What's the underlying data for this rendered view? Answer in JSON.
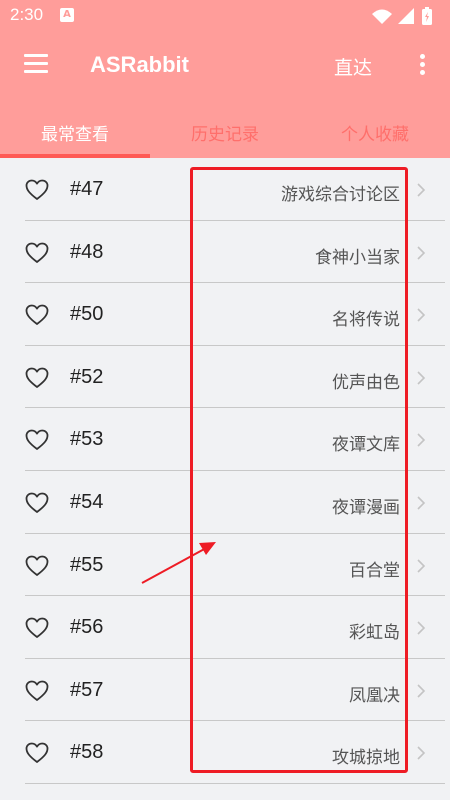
{
  "status_bar": {
    "time": "2:30",
    "notification_icon": "A"
  },
  "app_bar": {
    "title": "ASRabbit",
    "direct_label": "直达"
  },
  "tabs": [
    {
      "label": "最常查看",
      "active": true
    },
    {
      "label": "历史记录",
      "active": false
    },
    {
      "label": "个人收藏",
      "active": false
    }
  ],
  "items": [
    {
      "number": "#47",
      "name": "游戏综合讨论区"
    },
    {
      "number": "#48",
      "name": "食神小当家"
    },
    {
      "number": "#50",
      "name": "名将传说"
    },
    {
      "number": "#52",
      "name": "优声由色"
    },
    {
      "number": "#53",
      "name": "夜谭文库"
    },
    {
      "number": "#54",
      "name": "夜谭漫画"
    },
    {
      "number": "#55",
      "name": "百合堂"
    },
    {
      "number": "#56",
      "name": "彩虹岛"
    },
    {
      "number": "#57",
      "name": "凤凰决"
    },
    {
      "number": "#58",
      "name": "攻城掠地"
    }
  ],
  "colors": {
    "primary": "#ff9d9a",
    "tab_indicator": "#ff5a55",
    "tab_inactive": "#ff6f6b",
    "annotation": "#ee1c25",
    "background": "#f1f2f4"
  },
  "icons": {
    "menu": "hamburger-menu-icon",
    "overflow": "vertical-dots-icon",
    "favorite": "heart-outline-icon",
    "chevron": "chevron-right-icon"
  }
}
